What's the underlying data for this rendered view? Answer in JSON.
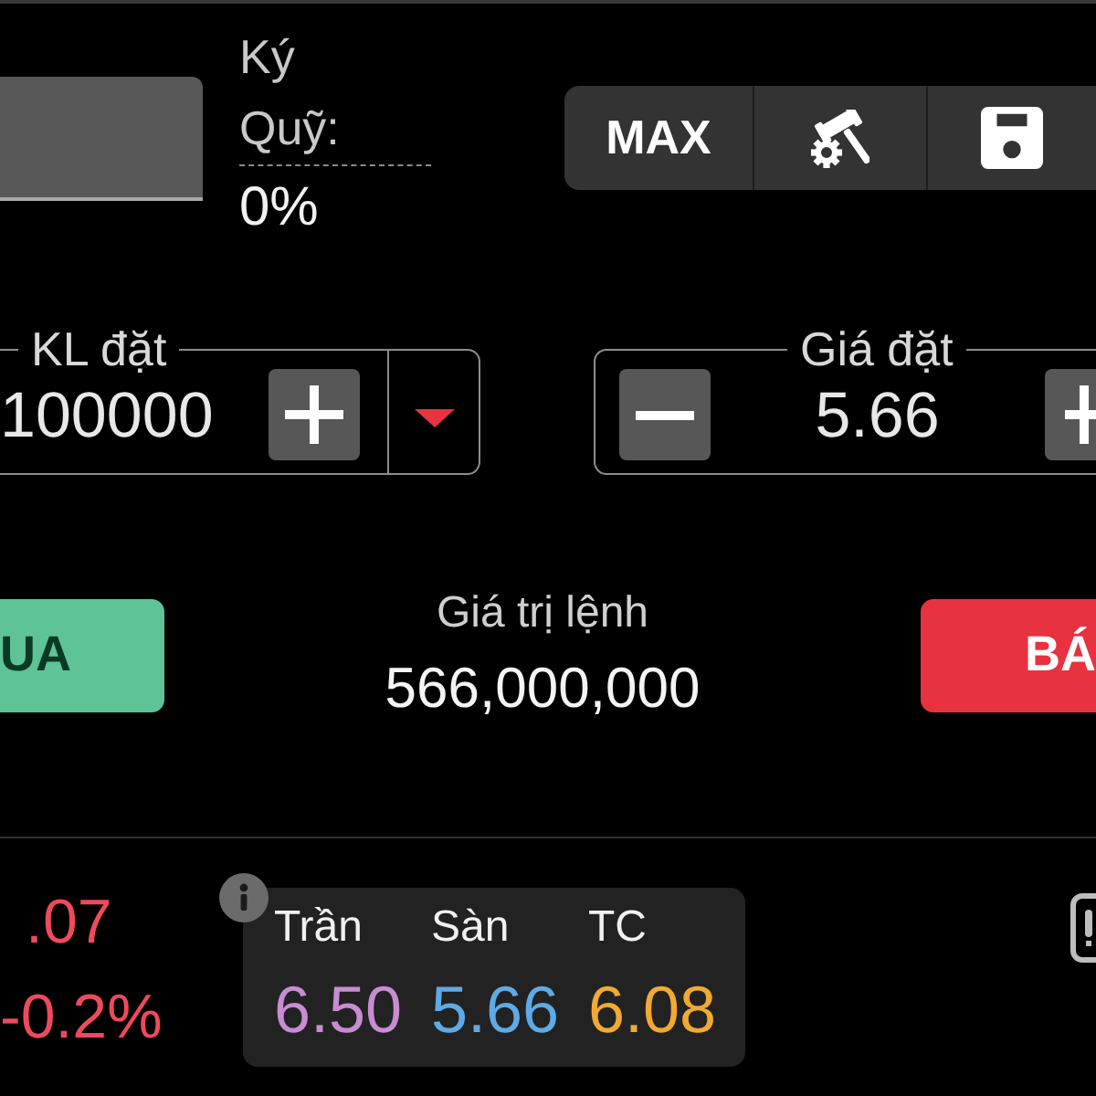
{
  "margin": {
    "label": "Ký Quỹ:",
    "value": "0%"
  },
  "toolbar": {
    "max_button": "MAX"
  },
  "quantity": {
    "label": "KL đặt",
    "value": "100000"
  },
  "price": {
    "label": "Giá đặt",
    "value": "5.66"
  },
  "actions": {
    "buy_button": "UA",
    "order_value_label": "Giá trị lệnh",
    "order_value": "566,000,000",
    "sell_button": "BÁ"
  },
  "quote": {
    "last_price": ".07",
    "change": "-0.2%",
    "reference_prices": [
      {
        "label": "Trần",
        "value": "6.50",
        "color": "#c88cd2"
      },
      {
        "label": "Sàn",
        "value": "5.66",
        "color": "#5faae6"
      },
      {
        "label": "TC",
        "value": "6.08",
        "color": "#f0aa32"
      }
    ]
  }
}
